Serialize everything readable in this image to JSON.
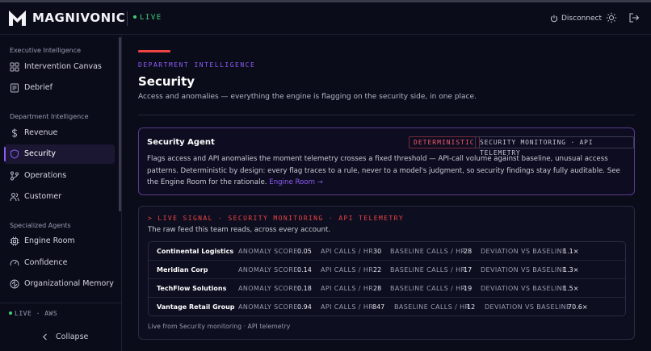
{
  "header": {
    "brand": "MAGNIVONIC",
    "live_badge": "LIVE",
    "disconnect_label": "Disconnect"
  },
  "sidebar": {
    "sections": [
      {
        "title": "Executive Intelligence",
        "items": [
          {
            "label": "Intervention Canvas",
            "icon": "grid-icon"
          },
          {
            "label": "Debrief",
            "icon": "document-icon"
          }
        ]
      },
      {
        "title": "Department Intelligence",
        "items": [
          {
            "label": "Revenue",
            "icon": "dollar-icon"
          },
          {
            "label": "Security",
            "icon": "shield-icon",
            "active": true
          },
          {
            "label": "Operations",
            "icon": "branch-icon"
          },
          {
            "label": "Customer",
            "icon": "users-icon"
          }
        ]
      },
      {
        "title": "Specialized Agents",
        "items": [
          {
            "label": "Engine Room",
            "icon": "cpu-icon"
          },
          {
            "label": "Confidence",
            "icon": "gauge-icon"
          },
          {
            "label": "Organizational Memory",
            "icon": "brain-icon"
          }
        ]
      }
    ],
    "status": "LIVE · AWS",
    "collapse_label": "Collapse"
  },
  "main": {
    "dept_label": "DEPARTMENT INTELLIGENCE",
    "title": "Security",
    "subtitle": "Access and anomalies — everything the engine is flagging on the security side, in one place.",
    "agent": {
      "name": "Security Agent",
      "tag_mode": "DETERMINISTIC",
      "tag_source": "SECURITY MONITORING · API TELEMETRY",
      "description": "Flags access and API anomalies the moment telemetry crosses a fixed threshold — API-call volume against baseline, unusual access patterns. Deterministic by design: every flag traces to a rule, never to a model's judgment, so security findings stay fully auditable. See the Engine Room for the rationale.",
      "link": "Engine Room →"
    },
    "signal": {
      "label": "> LIVE SIGNAL · SECURITY MONITORING · API TELEMETRY",
      "subtitle": "The raw feed this team reads, across every account.",
      "columns": {
        "anomaly": "ANOMALY SCORE",
        "calls": "API CALLS / HR",
        "baseline": "BASELINE CALLS / HR",
        "deviation": "DEVIATION VS BASELINE"
      },
      "rows": [
        {
          "account": "Continental Logistics",
          "anomaly": "0.05",
          "calls": "30",
          "baseline": "28",
          "deviation": "1.1×"
        },
        {
          "account": "Meridian Corp",
          "anomaly": "0.14",
          "calls": "22",
          "baseline": "17",
          "deviation": "1.3×"
        },
        {
          "account": "TechFlow Solutions",
          "anomaly": "0.18",
          "calls": "28",
          "baseline": "19",
          "deviation": "1.5×"
        },
        {
          "account": "Vantage Retail Group",
          "anomaly": "0.94",
          "calls": "847",
          "baseline": "12",
          "deviation": "70.6×"
        }
      ],
      "footer": "Live from Security monitoring · API telemetry"
    }
  },
  "colors": {
    "accent": "#8b5cf6",
    "alert": "#ef4444",
    "live": "#3fcf77",
    "background": "#0b0c1a"
  }
}
